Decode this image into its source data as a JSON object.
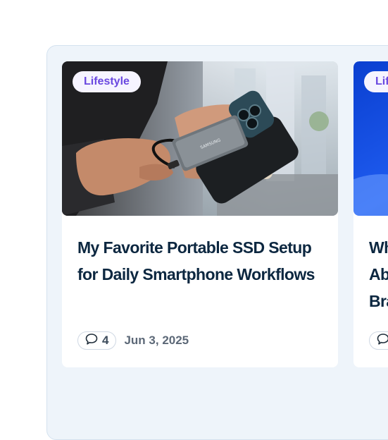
{
  "cards": [
    {
      "category": "Lifestyle",
      "title": "My Favorite Portable SSD Setup for Daily Smartphone Workflows",
      "comments": "4",
      "date": "Jun 3, 2025",
      "image": "photo of hands connecting a Samsung portable SSD to a smartphone",
      "ssd_brand_text": "SAMSUNG"
    },
    {
      "category": "Lif",
      "title_lines": [
        "Wh",
        "Ab",
        "Bra"
      ],
      "image": "blue abstract photo"
    }
  ],
  "icons": {
    "comment": "speech-bubble-icon"
  },
  "colors": {
    "badge_text": "#6a48e0",
    "title": "#0c2740",
    "panel": "#eef4fa"
  }
}
